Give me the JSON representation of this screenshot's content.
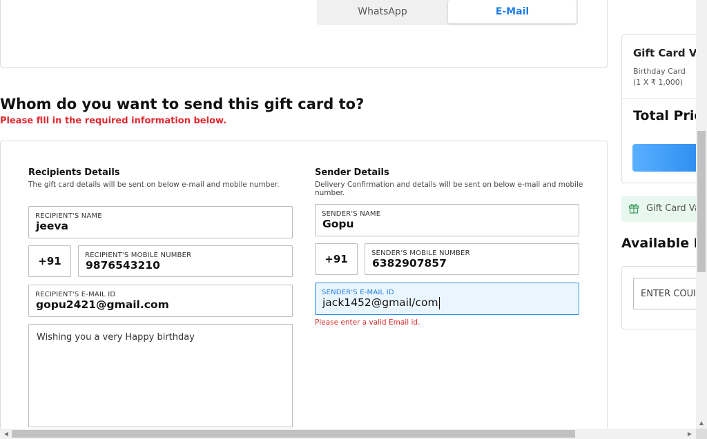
{
  "delivery": {
    "whatsapp_label": "WhatsApp",
    "email_label": "E-Mail",
    "selected": "E-Mail"
  },
  "form": {
    "heading": "Whom do you want to send this gift card to?",
    "required_note": "Please fill in the required information below.",
    "recipient": {
      "title": "Recipients Details",
      "description": "The gift card details will be sent on below e-mail and mobile number.",
      "name_label": "RECIPIENT'S NAME",
      "name_value": "jeeva",
      "country_code": "+91",
      "mobile_label": "RECIPIENT'S MOBILE NUMBER",
      "mobile_value": "9876543210",
      "email_label": "RECIPIENT'S E-MAIL ID",
      "email_value": "gopu2421@gmail.com",
      "message_value": "Wishing you a very Happy birthday"
    },
    "sender": {
      "title": "Sender Details",
      "description": "Delivery Confirmation and details will be sent on below e-mail and mobile number.",
      "name_label": "SENDER'S NAME",
      "name_value": "Gopu",
      "country_code": "+91",
      "mobile_label": "SENDER'S MOBILE NUMBER",
      "mobile_value": "6382907857",
      "email_label": "SENDER'S E-MAIL ID",
      "email_value": "jack1452@gmail/com",
      "email_error": "Please enter a valid Email id."
    }
  },
  "summary": {
    "title": "Gift Card Val",
    "item_name": "Birthday Card",
    "item_detail": "(1 X ₹ 1,000)",
    "total_label": "Total Price"
  },
  "promo": {
    "gift_label": "Gift Card Va",
    "available_heading": "Available Di",
    "coupon_placeholder": "ENTER COUI"
  },
  "colors": {
    "accent": "#1e7ee6",
    "error": "#e0272d",
    "active_field_bg": "#eaf6ff",
    "promo_bg": "#e8f7ef"
  },
  "icons": {
    "gift": "gift-icon",
    "scroll_up": "arrow-up-icon",
    "scroll_left": "arrow-left-icon",
    "scroll_right": "arrow-right-icon"
  }
}
